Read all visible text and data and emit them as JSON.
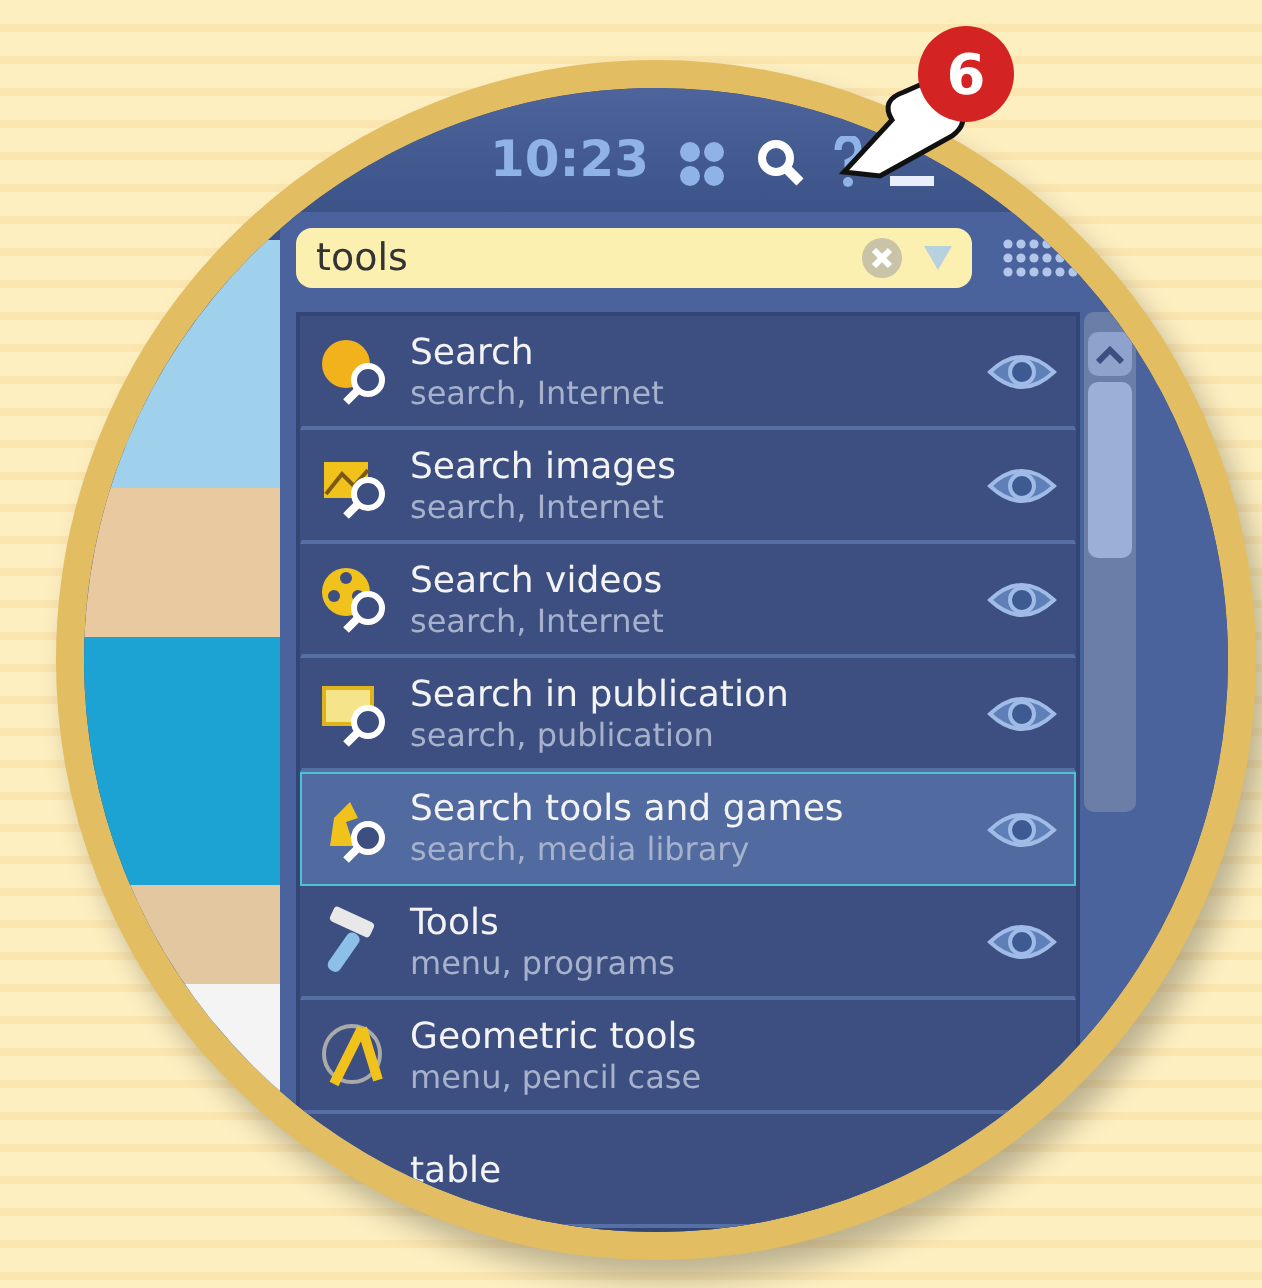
{
  "callout": {
    "number": "6"
  },
  "top_bar": {
    "time": "10:23"
  },
  "search": {
    "value": "tools"
  },
  "results": [
    {
      "kind": "globe",
      "title": "Search",
      "subtitle": "search, Internet",
      "preview": true,
      "selected": false
    },
    {
      "kind": "images",
      "title": "Search images",
      "subtitle": "search, Internet",
      "preview": true,
      "selected": false
    },
    {
      "kind": "videos",
      "title": "Search videos",
      "subtitle": "search, Internet",
      "preview": true,
      "selected": false
    },
    {
      "kind": "publication",
      "title": "Search in publication",
      "subtitle": "search, publication",
      "preview": true,
      "selected": false
    },
    {
      "kind": "games",
      "title": "Search tools and games",
      "subtitle": "search, media library",
      "preview": true,
      "selected": true
    },
    {
      "kind": "hammer",
      "title": "Tools",
      "subtitle": "menu, programs",
      "preview": true,
      "selected": false
    },
    {
      "kind": "compass",
      "title": "Geometric tools",
      "subtitle": "menu, pencil case",
      "preview": false,
      "selected": false
    },
    {
      "kind": "none",
      "title": "table",
      "preview": false,
      "selected": false
    }
  ]
}
